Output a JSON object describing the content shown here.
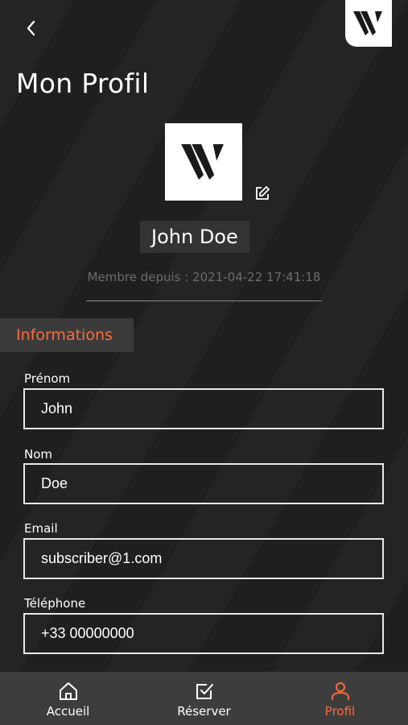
{
  "header": {
    "title": "Mon Profil",
    "back_icon": "chevron-left-icon",
    "logo": "brand-logo-icon"
  },
  "profile": {
    "name": "John Doe",
    "member_since": "Membre depuis : 2021-04-22 17:41:18",
    "edit_icon": "edit-icon"
  },
  "informations": {
    "section_title": "Informations",
    "fields": [
      {
        "label": "Prénom",
        "value": "John"
      },
      {
        "label": "Nom",
        "value": "Doe"
      },
      {
        "label": "Email",
        "value": "subscriber@1.com"
      },
      {
        "label": "Téléphone",
        "value": "+33 00000000"
      }
    ]
  },
  "nav": {
    "items": [
      {
        "label": "Accueil",
        "icon": "home-icon"
      },
      {
        "label": "Réserver",
        "icon": "checkbox-icon"
      },
      {
        "label": "Profil",
        "icon": "user-icon",
        "active": true
      }
    ]
  },
  "colors": {
    "background": "#1f1f1f",
    "accent": "#ff6a3d",
    "nav": "#3d3d3d"
  }
}
